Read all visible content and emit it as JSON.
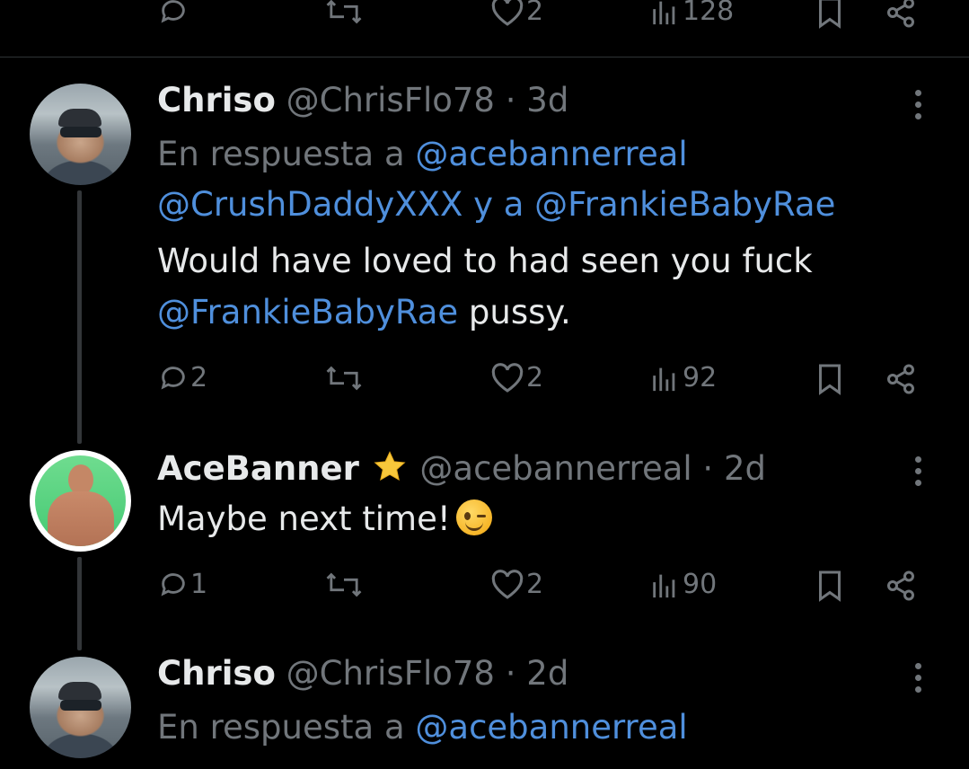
{
  "top_actions": {
    "replies": "",
    "retweets": "",
    "likes": "2",
    "views": "128"
  },
  "tweets": [
    {
      "name": "Chriso",
      "handle": "@ChrisFlo78",
      "sep": " · ",
      "time": "3d",
      "reply_prefix": "En respuesta a ",
      "reply_to_1": "@acebannerreal",
      "reply_to_2": "@CrushDaddyXXX",
      "reply_conj": " y a ",
      "reply_to_3": "@FrankieBabyRae",
      "text_line_1": "Would have loved to had seen you fuck",
      "text_mention": "@FrankieBabyRae",
      "text_tail": " pussy.",
      "actions": {
        "replies": "2",
        "retweets": "",
        "likes": "2",
        "views": "92"
      }
    },
    {
      "name": "AceBanner",
      "badge": "star",
      "handle": "@acebannerreal",
      "sep": " · ",
      "time": "2d",
      "text_line_1": "Maybe next time!",
      "emoji": "winking-face",
      "actions": {
        "replies": "1",
        "retweets": "",
        "likes": "2",
        "views": "90"
      }
    },
    {
      "name": "Chriso",
      "handle": "@ChrisFlo78",
      "sep": " · ",
      "time": "2d",
      "reply_prefix": "En respuesta a ",
      "reply_to_1": "@acebannerreal"
    }
  ],
  "colors": {
    "background": "#000000",
    "text": "#e7e9ea",
    "muted": "#71767b",
    "link": "#4f8fdc",
    "divider": "#2f3336"
  }
}
